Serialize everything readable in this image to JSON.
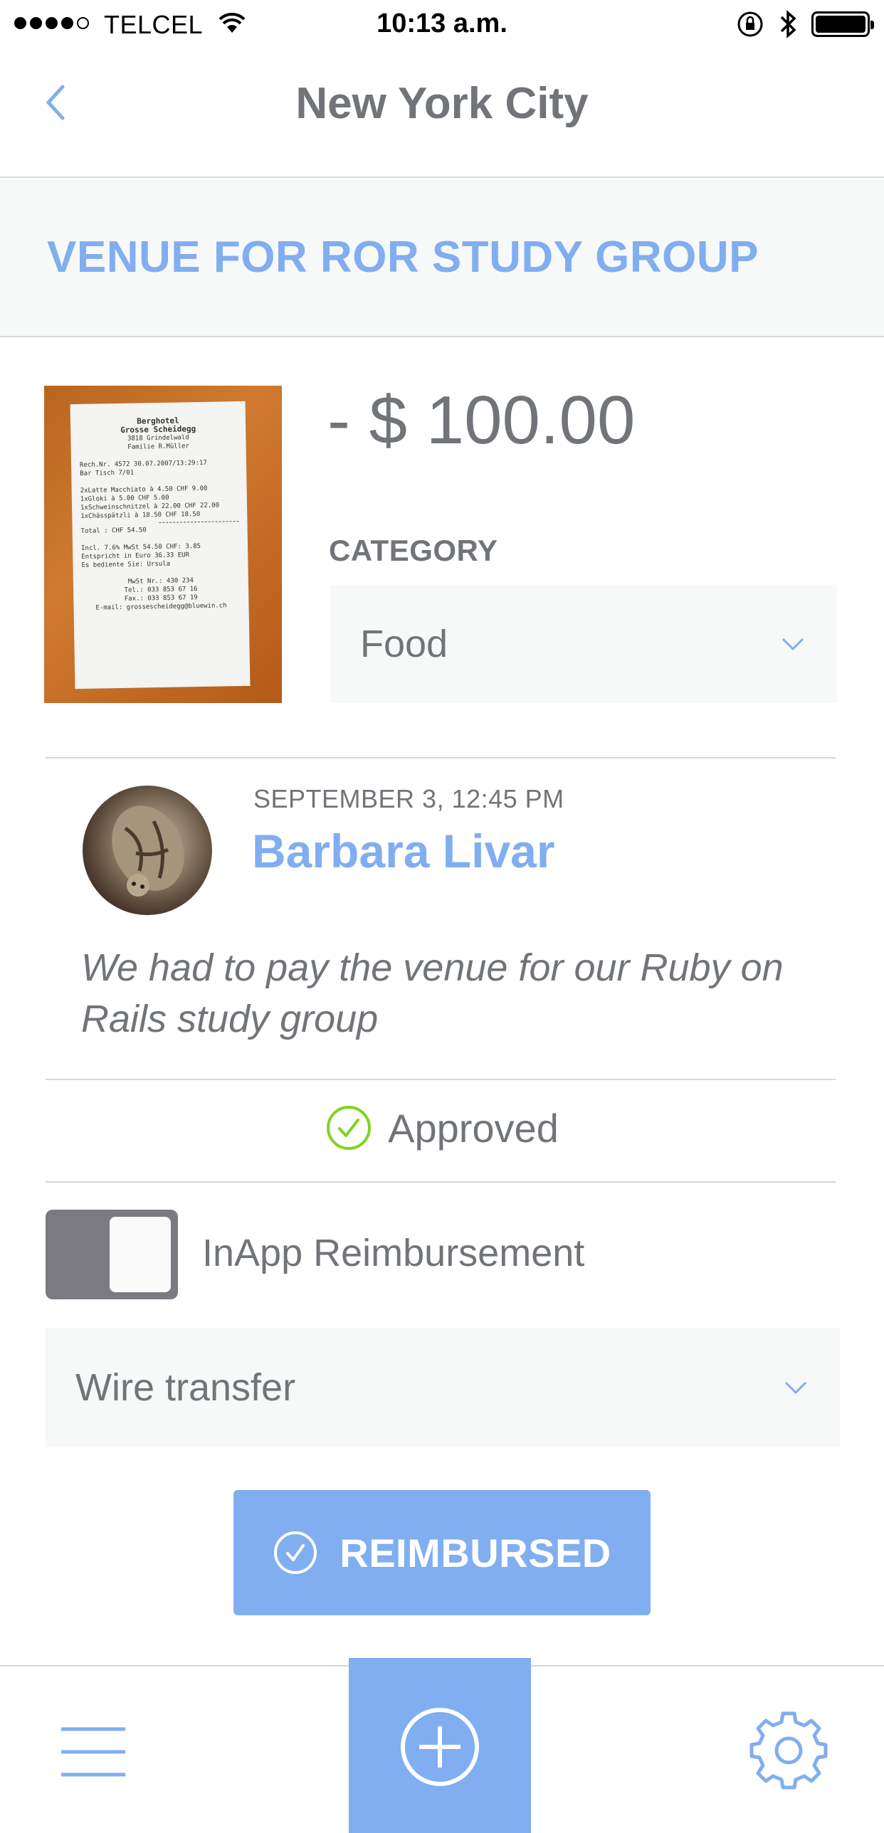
{
  "status_bar": {
    "carrier": "TELCEL",
    "time": "10:13 a.m."
  },
  "nav": {
    "title": "New York City",
    "back_icon": "chevron-left-icon"
  },
  "expense": {
    "title": "VENUE FOR ROR STUDY GROUP",
    "amount": "- $ 100.00",
    "category_label": "CATEGORY",
    "category_value": "Food"
  },
  "receipt": {
    "lines": [
      "Berghotel",
      "Grosse Scheidegg",
      "3818 Grindelwald",
      "Familie R.Müller"
    ],
    "meta": [
      "Rech.Nr. 4572      30.07.2007/13:29:17",
      "Bar                        Tisch  7/01"
    ],
    "items": [
      "2xLatte Macchiato  à  4.50 CHF   9.00",
      "1xGloki           à  5.00 CHF   5.00",
      "1xSchweinschnitzel à 22.00 CHF  22.00",
      "1xChässpätzli     à 18.50 CHF  18.50"
    ],
    "total": "Total :   CHF     54.50",
    "footer": [
      "Incl. 7.6% MwSt   54.50 CHF:    3.85",
      "",
      "Entspricht in Euro   36.33  EUR",
      "Es bediente Sie: Ursula",
      "",
      "MwSt Nr.: 430 234",
      "Tel.: 033 853 67 16",
      "Fax.: 033 853 67 19",
      "E-mail: grossescheidegg@bluewin.ch"
    ]
  },
  "submission": {
    "date": "SEPTEMBER 3, 12:45 PM",
    "name": "Barbara Livar",
    "note": "We had to pay the venue for our Ruby on Rails study group"
  },
  "approval": {
    "status": "Approved",
    "color": "#7ed321"
  },
  "reimbursement": {
    "toggle_label": "InApp Reimbursement",
    "toggle_on": false,
    "method": "Wire transfer",
    "button_label": "REIMBURSED"
  },
  "tabbar": {
    "left_icon": "menu-icon",
    "center_icon": "add-circle-icon",
    "right_icon": "gear-icon"
  },
  "colors": {
    "accent": "#80aef0",
    "text": "#717478",
    "background_alt": "#f7f8f8"
  }
}
